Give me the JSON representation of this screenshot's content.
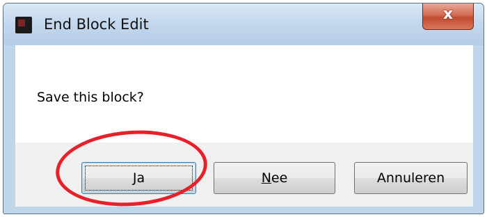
{
  "window": {
    "title": "End Block Edit",
    "close_glyph": "x",
    "app_icon": "block-editor-icon"
  },
  "dialog": {
    "message": "Save this block?"
  },
  "buttons": {
    "yes": {
      "label": "Ja",
      "mnemonic": "J"
    },
    "no": {
      "label": "Nee",
      "mnemonic": "N"
    },
    "cancel": {
      "label": "Annuleren"
    }
  },
  "annotation": {
    "color": "#e8202a",
    "target": "yes-button"
  },
  "colors": {
    "frame": "#bfd5ea",
    "close_button": "#c14a30",
    "button_bar": "#f0f0f0"
  }
}
